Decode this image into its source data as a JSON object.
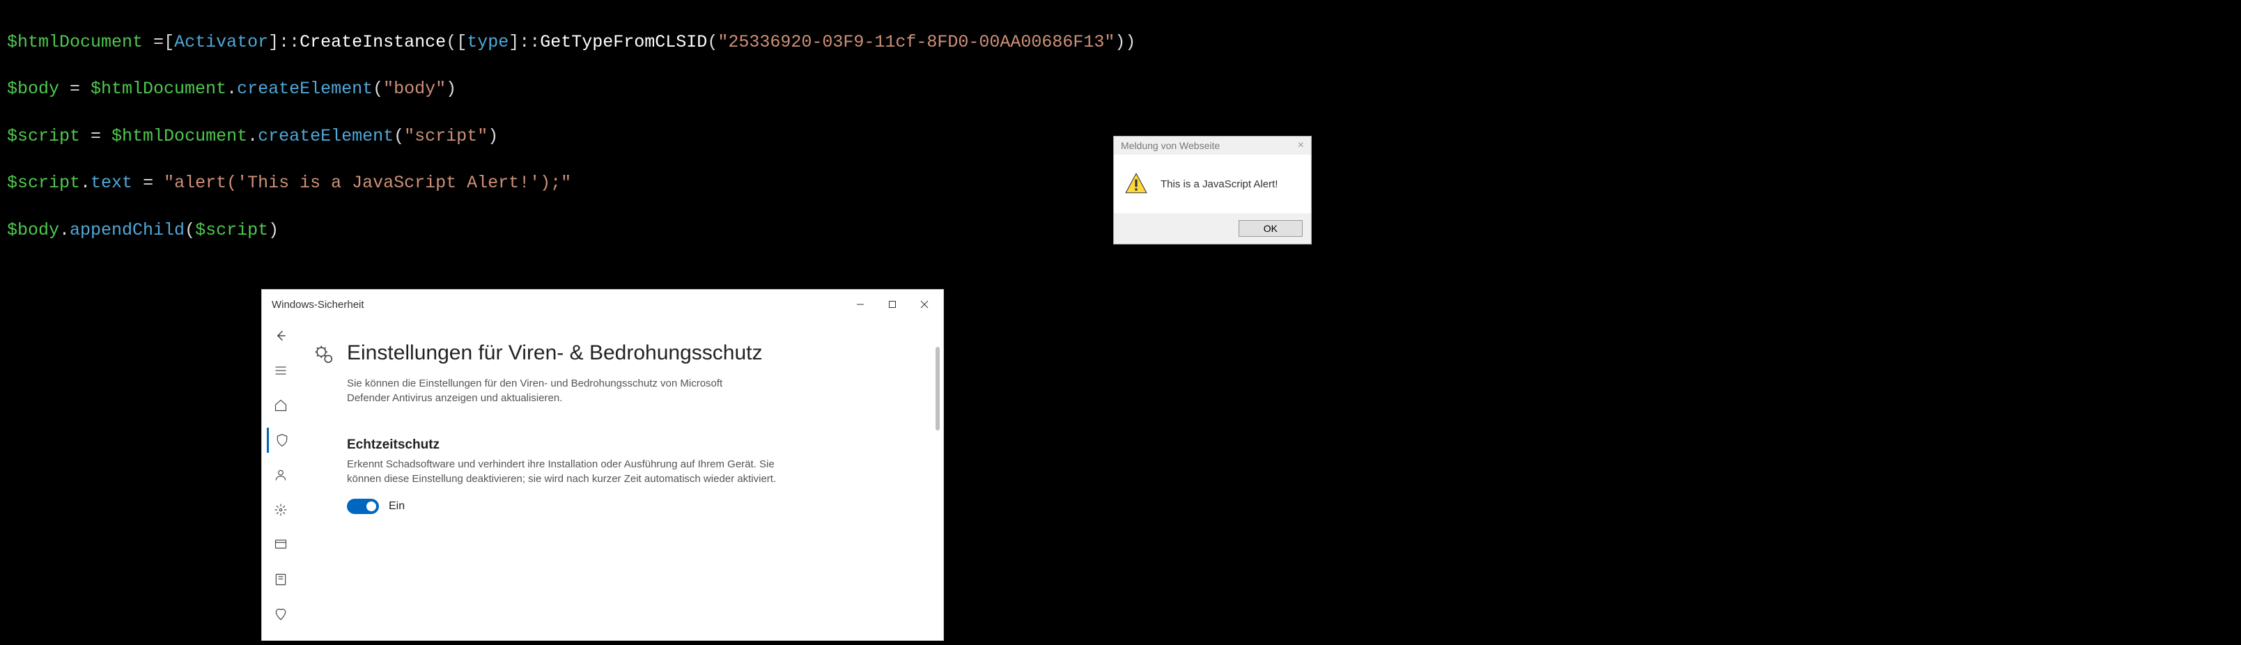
{
  "code": {
    "line1": {
      "v1": "$htmlDocument",
      "op1": " =",
      "brk1": "[",
      "cls1": "Activator",
      "brk2": "]",
      "op2": "::",
      "fn1": "CreateInstance",
      "par1": "(",
      "brk3": "[",
      "cls2": "type",
      "brk4": "]",
      "op3": "::",
      "fn2": "GetTypeFromCLSID",
      "par2": "(",
      "str1": "\"25336920-03F9-11cf-8FD0-00AA00686F13\"",
      "par3": "))"
    },
    "line2": {
      "v1": "$body",
      "op1": " = ",
      "v2": "$htmlDocument",
      "dot": ".",
      "fn": "createElement",
      "par1": "(",
      "str": "\"body\"",
      "par2": ")"
    },
    "line3": {
      "v1": "$script",
      "op1": " = ",
      "v2": "$htmlDocument",
      "dot": ".",
      "fn": "createElement",
      "par1": "(",
      "str": "\"script\"",
      "par2": ")"
    },
    "line4": {
      "v1": "$script",
      "dot": ".",
      "prop": "text",
      "op": " = ",
      "str": "\"alert('This is a JavaScript Alert!');\""
    },
    "line5": {
      "v1": "$body",
      "dot": ".",
      "fn": "appendChild",
      "par1": "(",
      "v2": "$script",
      "par2": ")"
    }
  },
  "msgbox": {
    "title": "Meldung von Webseite",
    "close": "×",
    "message": "This is a JavaScript Alert!",
    "ok": "OK"
  },
  "winsec": {
    "title": "Windows-Sicherheit",
    "heading": "Einstellungen für Viren- & Bedrohungsschutz",
    "desc": "Sie können die Einstellungen für den Viren- und Bedrohungsschutz von Microsoft Defender Antivirus anzeigen und aktualisieren.",
    "section_title": "Echtzeitschutz",
    "section_desc": "Erkennt Schadsoftware und verhindert ihre Installation oder Ausführung auf Ihrem Gerät. Sie können diese Einstellung deaktivieren; sie wird nach kurzer Zeit automatisch wieder aktiviert.",
    "toggle_label": "Ein"
  }
}
